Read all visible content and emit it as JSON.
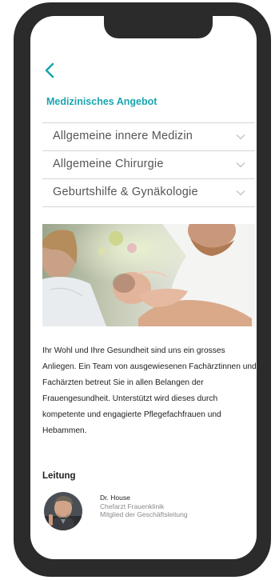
{
  "header": {
    "back_icon": "chevron-left-icon",
    "title": "Medizinisches Angebot"
  },
  "accordion": {
    "items": [
      {
        "label": "Allgemeine innere Medizin",
        "icon": "chevron-down-icon"
      },
      {
        "label": "Allgemeine Chirurgie",
        "icon": "chevron-down-icon"
      },
      {
        "label": "Geburtshilfe & Gynäkologie",
        "icon": "chevron-down-icon"
      }
    ]
  },
  "hero": {
    "description": "mother-father-newborn-photo"
  },
  "intro": {
    "text": "Ihr Wohl und Ihre Gesundheit sind uns ein grosses Anliegen. Ein Team von ausgewiesenen Fachärztinnen und Fachärzten betreut Sie in allen Belangen der Frauengesundheit. Unterstützt wird dieses durch kompetente und engagierte Pflegefachfrauen und Hebammen."
  },
  "leitung": {
    "heading": "Leitung",
    "person": {
      "name": "Dr. House",
      "role": "Chefarzt Frauenklinik",
      "position": "Mitglied der Geschäftsleitung"
    }
  },
  "colors": {
    "accent": "#1aa5b0",
    "frame": "#2b2b2b",
    "text": "#1e1e1e",
    "muted": "#8a8a8a",
    "divider": "#d6d6d6"
  }
}
